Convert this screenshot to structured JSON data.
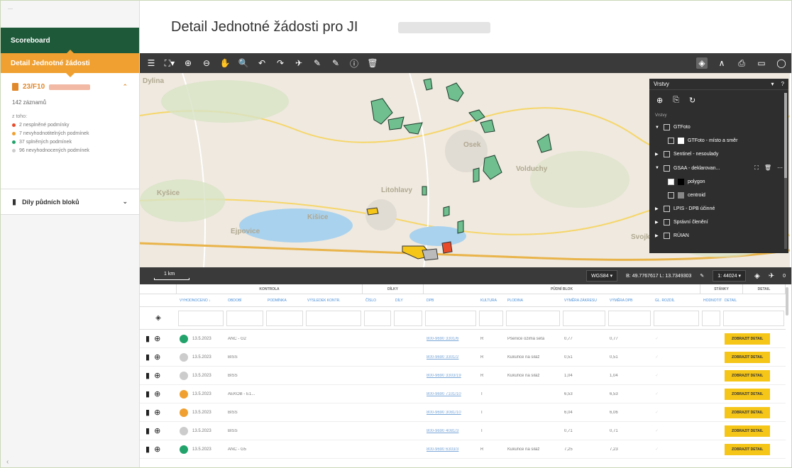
{
  "sidebar": {
    "logo_text": "—",
    "scoreboard": "Scoreboard",
    "detail_nav": "Detail Jednotné žádosti",
    "application": {
      "id": "23/F10",
      "records": "142 záznamů",
      "from_label": "z toho:",
      "conditions": [
        {
          "text": "2 nesplněné podmínky",
          "color": "#e94b2a"
        },
        {
          "text": "7 nevyhodnotitelných podmínek",
          "color": "#f0a030"
        },
        {
          "text": "37 splněných podmínek",
          "color": "#21a36b"
        },
        {
          "text": "96 nevyhodnocených podmínek",
          "color": "#cccccc"
        }
      ]
    },
    "blocks_label": "Díly půdních bloků",
    "collapse_glyph": "‹"
  },
  "page": {
    "title": "Detail Jednotné žádosti pro JI"
  },
  "toolbar": {
    "left_icons": [
      "☰",
      "⛶▾",
      "⊕",
      "⊖",
      "✋",
      "🔍",
      "↶",
      "↷",
      "✈",
      "✎",
      "✎",
      "ⓘ",
      "🗑"
    ],
    "right_icons": [
      "◈",
      "∧",
      "⎙",
      "▭",
      "◯"
    ]
  },
  "map": {
    "places": [
      {
        "name": "Dylina"
      },
      {
        "name": "Osek"
      },
      {
        "name": "Kyšice"
      },
      {
        "name": "Litohlavy"
      },
      {
        "name": "Kišice"
      },
      {
        "name": "Volduchy"
      },
      {
        "name": "Ejpovice"
      },
      {
        "name": "Svojkovice"
      }
    ]
  },
  "layers": {
    "title": "Vrstvy",
    "subtitle": "Vrstvy",
    "header_icons": [
      "▾",
      "?"
    ],
    "tool_icons": [
      "⊕",
      "⎘",
      "↻"
    ],
    "items": [
      {
        "label": "GTFoto",
        "indent": false,
        "tri": "▼",
        "checked": false
      },
      {
        "label": "GTFoto - místo a směr",
        "indent": true,
        "tri": "",
        "checked": false,
        "swatch": "#ffffff"
      },
      {
        "label": "Sentinel - nesoulady",
        "indent": false,
        "tri": "▶",
        "checked": false
      },
      {
        "label": "GSAA - deklarovan...",
        "indent": false,
        "tri": "▼",
        "checked": false,
        "actions": [
          "⛶",
          "🗑",
          "⋯"
        ]
      },
      {
        "label": "polygon",
        "indent": true,
        "tri": "",
        "checked": true,
        "swatch": "#000000"
      },
      {
        "label": "centroid",
        "indent": true,
        "tri": "",
        "checked": false,
        "swatch": "#888888"
      },
      {
        "label": "LPIS - DPB účinné",
        "indent": false,
        "tri": "▶",
        "checked": false
      },
      {
        "label": "Správní členění",
        "indent": false,
        "tri": "▶",
        "checked": false
      },
      {
        "label": "RÚIAN",
        "indent": false,
        "tri": "▶",
        "checked": false
      }
    ]
  },
  "statusbar": {
    "scale": "1 km",
    "crs": "WGS84",
    "coords": "B: 49.7767617   L: 13.7349303",
    "zoom": "1: 44024",
    "count": "0"
  },
  "table": {
    "groups": [
      {
        "label": "",
        "w": 52
      },
      {
        "label": "KONTROLA",
        "w": 262
      },
      {
        "label": "DÍLKY",
        "w": 86
      },
      {
        "label": "PŮDNÍ BLOK",
        "w": 390
      },
      {
        "label": "STÁNKY",
        "w": 60
      },
      {
        "label": "DETAIL",
        "w": 60
      }
    ],
    "columns": [
      {
        "label": "",
        "w": 52
      },
      {
        "label": "VYHODNOCENO  ↓",
        "w": 68
      },
      {
        "label": "OBDOBÍ",
        "w": 56
      },
      {
        "label": "PODMÍNKA",
        "w": 56
      },
      {
        "label": "VÝSLEDEK KONTR.",
        "w": 82
      },
      {
        "label": "ČÍSLO",
        "w": 42
      },
      {
        "label": "DÍLY",
        "w": 44
      },
      {
        "label": "DPB",
        "w": 76
      },
      {
        "label": "KULTURA",
        "w": 38
      },
      {
        "label": "PLODINA",
        "w": 80
      },
      {
        "label": "VÝMĚRA ZÁKRESU",
        "w": 64
      },
      {
        "label": "VÝMĚRA DPB",
        "w": 64
      },
      {
        "label": "GL. ROZDÍL",
        "w": 68
      },
      {
        "label": "HODNOTIT",
        "w": 30
      },
      {
        "label": "DETAIL",
        "w": 90
      }
    ],
    "detail_btn": "ZOBRAZIT DETAIL",
    "rows": [
      {
        "status": "#21a36b",
        "date": "13.5.2023",
        "cond": "ANC - G2",
        "dpb": "800-9690 3301/6",
        "k": "R",
        "crop": "Pšenice ozimá setá",
        "a1": "0,77",
        "a2": "0,77"
      },
      {
        "status": "#cccccc",
        "date": "13.5.2023",
        "cond": "BISS",
        "dpb": "800-9690 3301/2",
        "k": "R",
        "crop": "Kukuřice na siláž",
        "a1": "0,51",
        "a2": "0,51"
      },
      {
        "status": "#cccccc",
        "date": "13.5.2023",
        "cond": "BISS",
        "dpb": "800-9690 3303/19",
        "k": "R",
        "crop": "Kukuřice na siláž",
        "a1": "1,04",
        "a2": "1,04"
      },
      {
        "status": "#f0a030",
        "date": "13.5.2023",
        "cond": "AEKOB - E1...",
        "dpb": "800-9690 7101/10",
        "k": "T",
        "crop": "",
        "a1": "6,53",
        "a2": "6,53"
      },
      {
        "status": "#f0a030",
        "date": "13.5.2023",
        "cond": "BISS",
        "dpb": "800-9690 3081/10",
        "k": "T",
        "crop": "",
        "a1": "6,04",
        "a2": "6,06"
      },
      {
        "status": "#cccccc",
        "date": "13.5.2023",
        "cond": "BISS",
        "dpb": "800-9690 4081/3",
        "k": "T",
        "crop": "",
        "a1": "0,71",
        "a2": "0,71"
      },
      {
        "status": "#21a36b",
        "date": "13.5.2023",
        "cond": "ANC - G5",
        "dpb": "800-9690 6303/3",
        "k": "R",
        "crop": "Kukuřice na siláž",
        "a1": "7,25",
        "a2": "7,23"
      }
    ]
  }
}
